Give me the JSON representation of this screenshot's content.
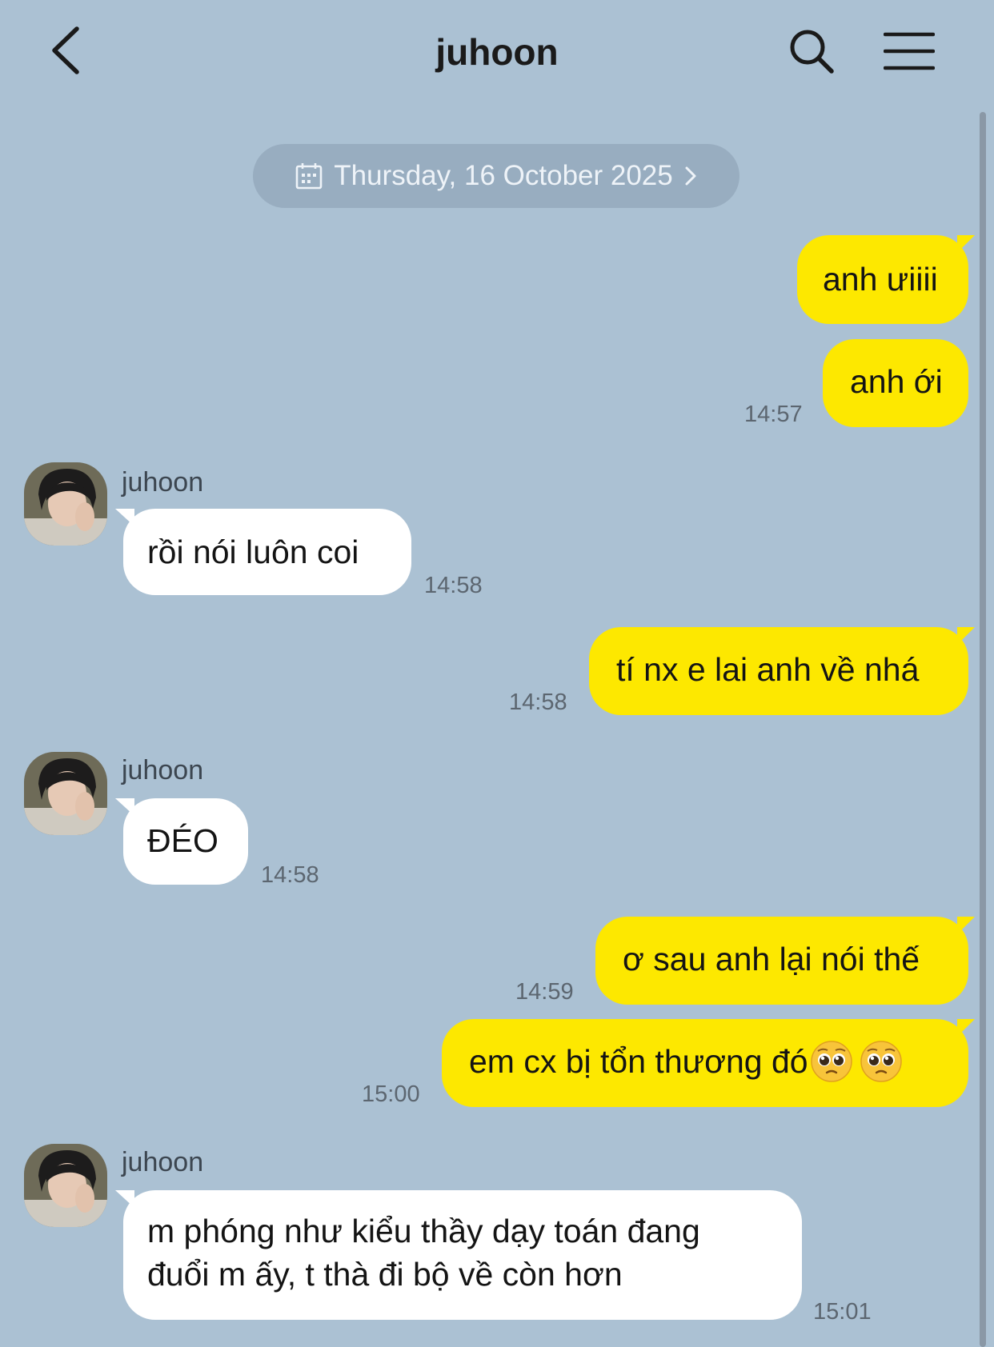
{
  "header": {
    "title": "juhoon"
  },
  "date_pill": {
    "label": "Thursday, 16 October 2025"
  },
  "messages": [
    {
      "dir": "out",
      "text": "anh ưiiii",
      "time": ""
    },
    {
      "dir": "out",
      "text": "anh ới",
      "time": "14:57"
    },
    {
      "dir": "in",
      "sender": "juhoon",
      "text": "rồi nói luôn coi",
      "time": "14:58"
    },
    {
      "dir": "out",
      "text": "tí nx e lai anh về nhá",
      "time": "14:58"
    },
    {
      "dir": "in",
      "sender": "juhoon",
      "text": "ĐÉO",
      "time": "14:58"
    },
    {
      "dir": "out",
      "text": "ơ sau anh lại nói thế",
      "time": "14:59"
    },
    {
      "dir": "out",
      "text": "em cx bị tổn thương đó",
      "emoji": "pleading-face-emoji x2",
      "time": "15:00"
    },
    {
      "dir": "in",
      "sender": "juhoon",
      "line1": "m phóng như kiểu thầy dạy toán đang",
      "line2": "đuổi m ấy, t thà đi bộ về còn hơn",
      "time": "15:01"
    }
  ],
  "colors": {
    "background": "#abc1d3",
    "outgoing_bubble": "#fde800",
    "incoming_bubble": "#ffffff",
    "date_pill": "#98adc0"
  }
}
